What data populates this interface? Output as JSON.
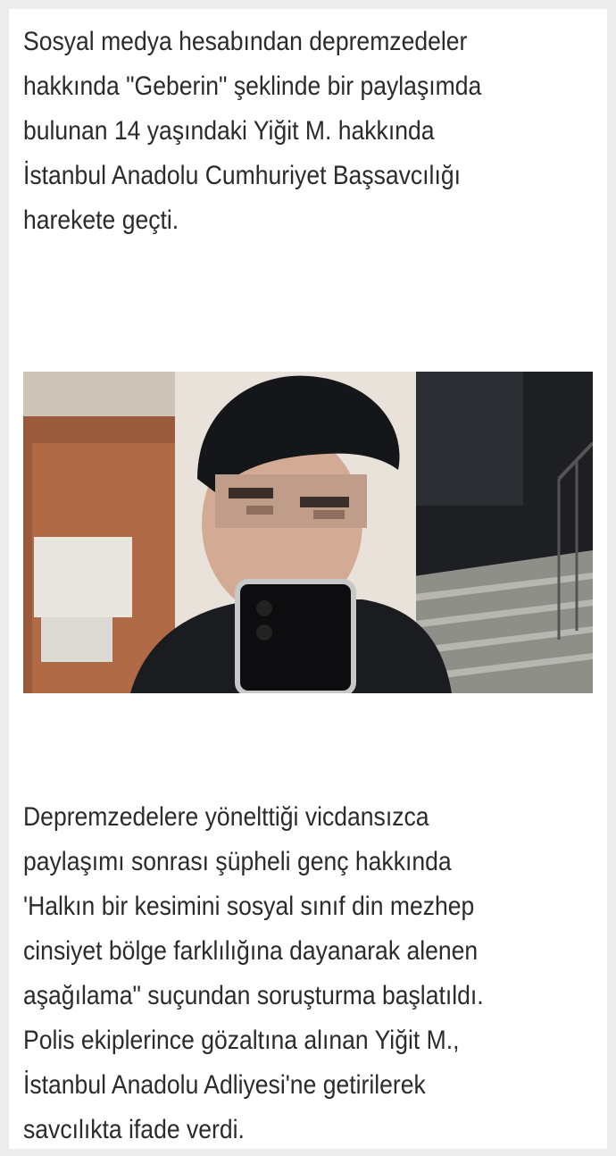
{
  "article": {
    "intro_lines": [
      "Sosyal medya hesabından depremzedeler",
      "hakkında \"Geberin\" şeklinde bir paylaşımda",
      "bulunan 14 yaşındaki Yiğit M. hakkında",
      "İstanbul Anadolu Cumhuriyet Başsavcılığı",
      "harekete geçti."
    ],
    "body_lines": [
      "Depremzedelere yönelttiği vicdansızca",
      "paylaşımı sonrası şüpheli genç hakkında",
      "'Halkın bir kesimini sosyal sınıf din mezhep",
      "cinsiyet bölge farklılığına dayanarak alenen",
      "aşağılama\" suçundan soruşturma başlatıldı.",
      "Polis ekiplerince gözaltına alınan Yiğit M.,",
      "İstanbul Anadolu Adliyesi'ne getirilerek",
      "savcılıkta ifade verdi."
    ]
  }
}
